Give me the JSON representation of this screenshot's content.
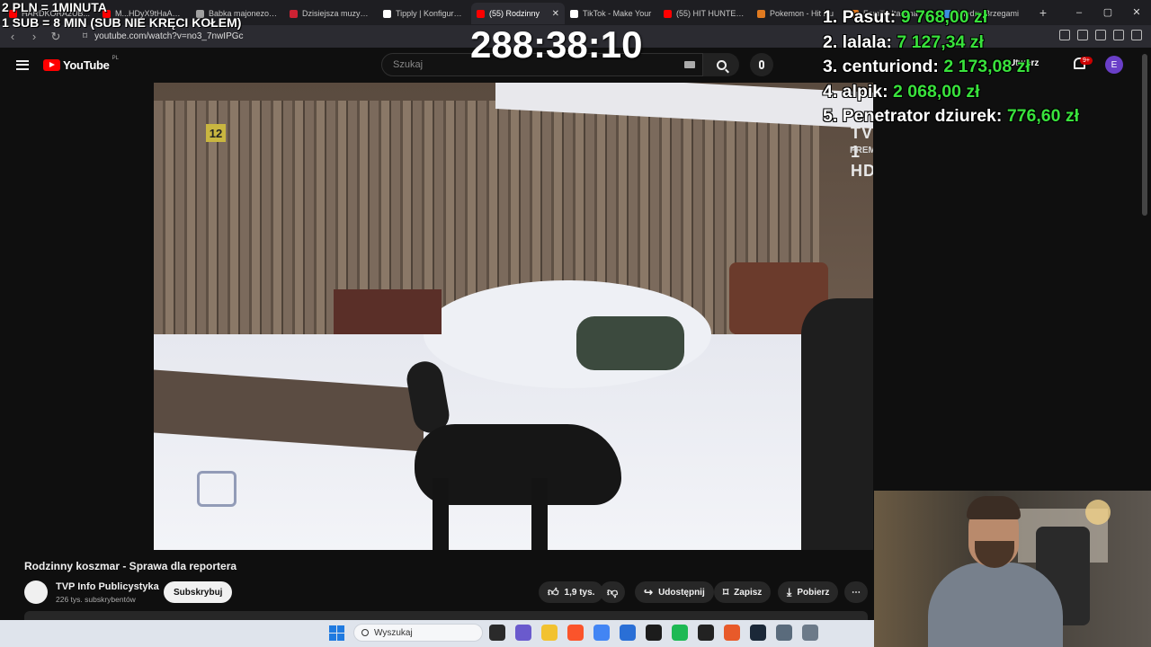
{
  "tabs": [
    {
      "label": "HARDKORA2UB...",
      "fav": "#ff0000",
      "active": false
    },
    {
      "label": "M...HDyX9tHaAAATDVE",
      "fav": "#ff0000",
      "active": false
    },
    {
      "label": "Babka majonezowa",
      "fav": "#a0a0a0",
      "active": false
    },
    {
      "label": "Dzisiejsza muzyczna",
      "fav": "#cc2233",
      "active": false
    },
    {
      "label": "Tipply | Konfigurator",
      "fav": "#ffffff",
      "active": false
    },
    {
      "label": "(55) Rodzinny",
      "fav": "#ff0000",
      "active": true
    },
    {
      "label": "TikTok - Make Your",
      "fav": "#ffffff",
      "active": false
    },
    {
      "label": "(55) HIT HUNTERS",
      "fav": "#ff0000",
      "active": false
    },
    {
      "label": "Pokemon - Hit Hu",
      "fav": "#e07a20",
      "active": false
    },
    {
      "label": "Familia Italiana W",
      "fav": "#e07a20",
      "active": false
    },
    {
      "label": "Między Brzegami",
      "fav": "#3b8de0",
      "active": false
    }
  ],
  "tab_close": "✕",
  "new_tab": "+",
  "window_controls": {
    "minimize": "–",
    "maximize": "▢",
    "close": "✕"
  },
  "address": {
    "url": "youtube.com/watch?v=no3_7nwIPGc"
  },
  "youtube": {
    "logo_text": "YouTube",
    "country": "PL",
    "search_placeholder": "Szukaj",
    "create_label": "Utwórz",
    "notif_badge": "9+",
    "avatar_letter": "E"
  },
  "overlay": {
    "line1": "2 PLN = 1MINUTA",
    "line2": "1 SUB = 8 MIN (SUB NIE KRĘCI KOŁEM)",
    "timer": "288:38:10"
  },
  "leaderboard": [
    {
      "name": "1. Pasut:",
      "amount": "9 768,00 zł"
    },
    {
      "name": "2. lalala:",
      "amount": "7 127,34 zł"
    },
    {
      "name": "3. centuriond:",
      "amount": "2 173,08 zł"
    },
    {
      "name": "4. alpik:",
      "amount": "2 068,00 zł"
    },
    {
      "name": "5. Penetrator dziurek:",
      "amount": "776,60 zł"
    }
  ],
  "video": {
    "age_badge": "12",
    "channel_bug": "TVP 1 HD",
    "premiere": "PREMIERA",
    "title": "Rodzinny koszmar - Sprawa dla reportera"
  },
  "channel": {
    "name": "TVP Info Publicystyka",
    "subs": "226 tys. subskrybentów",
    "subscribe": "Subskrybuj"
  },
  "actions": {
    "likes": "1,9 tys.",
    "share": "Udostępnij",
    "save": "Zapisz",
    "download": "Pobierz",
    "more": "⋯"
  },
  "taskbar": {
    "search_placeholder": "Wyszukaj",
    "icon_colors": [
      "#2a2a2a",
      "#6a5acd",
      "#f2c230",
      "#fb542b",
      "#4285f4",
      "#2a6fd6",
      "#1c1c1c",
      "#1db954",
      "#222222",
      "#e85a2a",
      "#1b2838",
      "#5a6b7c",
      "#6c7a89"
    ]
  }
}
